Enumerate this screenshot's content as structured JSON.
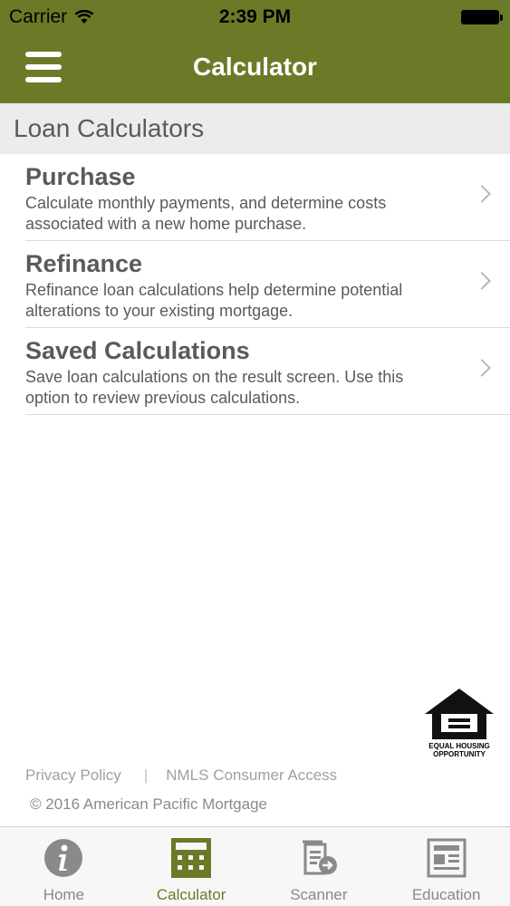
{
  "status_bar": {
    "carrier": "Carrier",
    "time": "2:39 PM"
  },
  "nav": {
    "title": "Calculator",
    "menu_icon": "hamburger-icon"
  },
  "section": {
    "header": "Loan Calculators"
  },
  "items": [
    {
      "title": "Purchase",
      "description": "Calculate monthly payments, and determine costs associated with a new home purchase."
    },
    {
      "title": "Refinance",
      "description": "Refinance loan calculations help determine potential alterations to your existing mortgage."
    },
    {
      "title": "Saved Calculations",
      "description": "Save loan calculations on the result screen. Use this option to review previous calculations."
    }
  ],
  "logo": {
    "text_line1": "EQUAL HOUSING",
    "text_line2": "OPPORTUNITY"
  },
  "footer": {
    "privacy": "Privacy Policy",
    "separator": "|",
    "nmls": "NMLS Consumer Access",
    "copyright": "© 2016 American Pacific Mortgage"
  },
  "tabs": [
    {
      "label": "Home",
      "icon": "info-icon"
    },
    {
      "label": "Calculator",
      "icon": "calculator-icon",
      "active": true
    },
    {
      "label": "Scanner",
      "icon": "scanner-icon"
    },
    {
      "label": "Education",
      "icon": "newspaper-icon"
    }
  ],
  "colors": {
    "brand": "#6b7a27",
    "tab_inactive": "#888888"
  }
}
